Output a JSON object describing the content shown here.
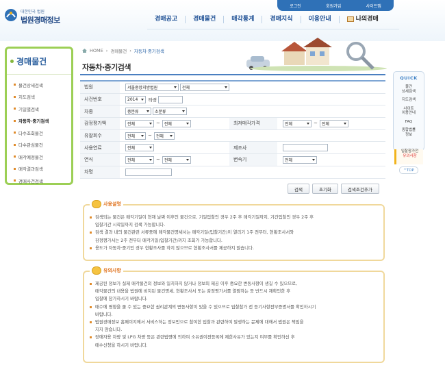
{
  "header": {
    "logo_small": "대한민국 법원",
    "logo_big": "법원경매정보",
    "util": [
      "로그인",
      "회원가입",
      "사이트맵"
    ],
    "gnb": [
      "경매공고",
      "경매물건",
      "매각통계",
      "경매지식",
      "이용안내",
      "나의경매"
    ]
  },
  "lnb": {
    "title": "경매물건",
    "items": [
      "물건상세검색",
      "지도검색",
      "기일별검색",
      "자동차·중기검색",
      "다수조회물건",
      "다수관심물건",
      "매각예정물건",
      "매각결과검색",
      "경매사건검색"
    ]
  },
  "breadcrumb": [
    "HOME",
    "경매물건",
    "자동차·중기검색"
  ],
  "page_title": "자동차·중기검색",
  "form": {
    "court": {
      "label": "법원",
      "select1": "서울중앙지방법원",
      "select2": "전체"
    },
    "case_no": {
      "label": "사건번호",
      "year": "2014",
      "type": "타경",
      "value": ""
    },
    "vehicle": {
      "label": "차종",
      "major": "중분류",
      "minor": "소분류"
    },
    "appraisal": {
      "label": "감정평가액",
      "from": "전체",
      "to": "전체"
    },
    "min_price": {
      "label": "최저매각가격",
      "from": "전체",
      "to": "전체"
    },
    "fail_count": {
      "label": "유찰회수",
      "from": "전체",
      "to": "전체"
    },
    "usage": {
      "label": "사용연료",
      "value": "전체"
    },
    "maker": {
      "label": "제조사",
      "value": ""
    },
    "year": {
      "label": "연식",
      "from": "전체",
      "to": "전체"
    },
    "transmission": {
      "label": "변속기",
      "value": "전체"
    },
    "model": {
      "label": "차명",
      "value": ""
    }
  },
  "buttons": {
    "search": "검색",
    "reset": "초기화",
    "detail": "검색조건추가"
  },
  "usage_box": {
    "title": "사용설명",
    "lines": [
      {
        "b": true,
        "t": "검색되는 물건은 매각기일이 현재 날짜 이후인 물건으로, 기일입찰인 경우 2주 후 매각기일까지, 기간입찰인 경우 2주 후"
      },
      {
        "b": false,
        "t": "입찰기간 시작일까지 검색 가능합니다."
      },
      {
        "b": true,
        "t": "검색 결과 내의 물건관련 서류중에 매각물건명세서는 매각기일(입찰기간)이 열리기 1주 전부터, 현황조사서와"
      },
      {
        "b": false,
        "t": "감정평가서는 2주 전부터 매각기일(입찰기간)까지 조회가 가능합니다."
      },
      {
        "b": true,
        "t": "용도가 자동차·중기인 경우 현황조사를 하지 않으므로 현황조사서를 제공하지 않습니다."
      }
    ]
  },
  "caution_box": {
    "title": "유의사항",
    "lines": [
      {
        "b": true,
        "t": "제공된 정보가 실제 매각물건의 정보와 일치하지 않거나 정보의 제공 이후 중요한 변동사항이 생길 수 있으므로,"
      },
      {
        "b": false,
        "t": "매각물건의 내용을 법원에 비치된 물건명세, 현황조사서 또는 감정평가서를 열람하는 등 반드시 재확인한 후"
      },
      {
        "b": false,
        "t": "입찰에 참가하시기 바랍니다."
      },
      {
        "b": true,
        "t": "매수에 영향을 줄 수 있는 중요한 권리관계의 변동사항이 있을 수 있으므로 입찰참가 전 등기사항전부증명서를 확인하시기"
      },
      {
        "b": false,
        "t": "바랍니다."
      },
      {
        "b": true,
        "t": "법원경매정보 홈페이지에서 서비스하는 정보만으로 참여한 입찰과 관련하여 발생하는 문제에 대해서 법원은 책임을"
      },
      {
        "b": false,
        "t": "지지 않습니다."
      },
      {
        "b": true,
        "t": "장애자용 차량 및 LPG 차량 등은 관련법령에 의하여 소유권이전등록에 제한사유가 있는지 여부를 확인하신 후"
      },
      {
        "b": false,
        "t": "매수신청을 하시기 바랍니다."
      }
    ]
  },
  "quick": {
    "title": "QUICK",
    "items": [
      "물건\n상세검색",
      "지도검색",
      "사이트\n이용안내",
      "FAQ",
      "종합법률\n정보"
    ],
    "notice_line1": "입찰참가전",
    "notice_line2": "유의사항",
    "top": "TOP"
  },
  "colors": {
    "accent": "#2f71b7",
    "lnb_border": "#9ccf55",
    "box_border": "#f0d89b",
    "warn": "#e0731e"
  }
}
